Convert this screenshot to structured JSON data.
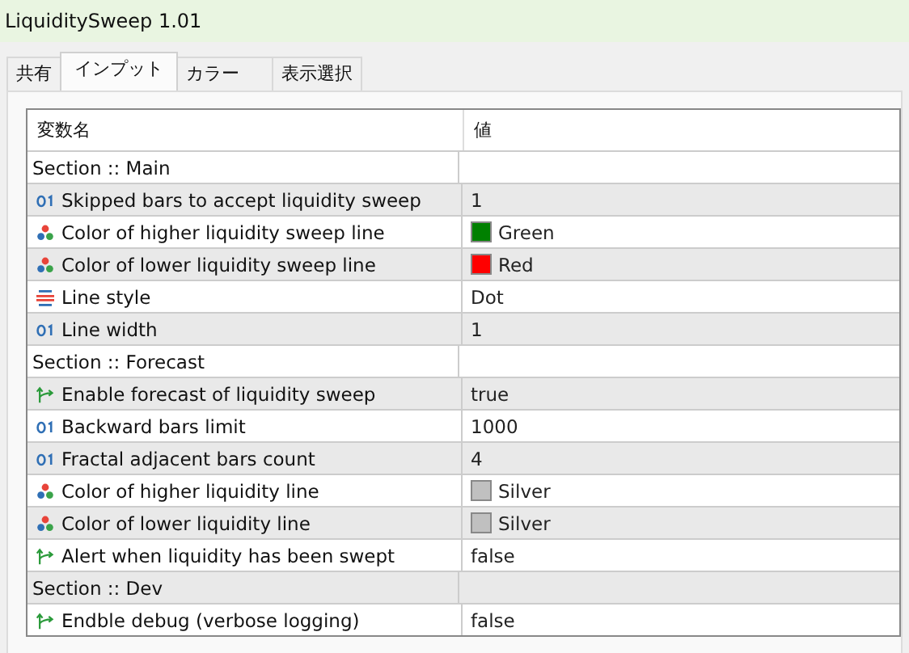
{
  "window": {
    "title": "LiquiditySweep 1.01"
  },
  "tabs": [
    {
      "label": "共有",
      "selected": false
    },
    {
      "label": "インプット",
      "selected": true
    },
    {
      "label": "カラー",
      "selected": false
    },
    {
      "label": "表示選択",
      "selected": false
    }
  ],
  "table": {
    "columns": [
      "変数名",
      "値"
    ],
    "rows": [
      {
        "kind": "section",
        "name": "Section :: Main"
      },
      {
        "kind": "int",
        "name": "Skipped bars to accept liquidity sweep",
        "value": "1"
      },
      {
        "kind": "color",
        "name": "Color of higher liquidity sweep line",
        "value": "Green",
        "color": "#008000"
      },
      {
        "kind": "color",
        "name": "Color of lower liquidity sweep line",
        "value": "Red",
        "color": "#ff0000"
      },
      {
        "kind": "enum",
        "name": "Line style",
        "value": "Dot"
      },
      {
        "kind": "int",
        "name": "Line width",
        "value": "1"
      },
      {
        "kind": "section",
        "name": "Section :: Forecast"
      },
      {
        "kind": "bool",
        "name": "Enable forecast of liquidity sweep",
        "value": "true"
      },
      {
        "kind": "int",
        "name": "Backward bars limit",
        "value": "1000"
      },
      {
        "kind": "int",
        "name": "Fractal adjacent bars count",
        "value": "4"
      },
      {
        "kind": "color",
        "name": "Color of higher liquidity line",
        "value": "Silver",
        "color": "#c0c0c0"
      },
      {
        "kind": "color",
        "name": "Color of lower liquidity line",
        "value": "Silver",
        "color": "#c0c0c0"
      },
      {
        "kind": "bool",
        "name": "Alert when liquidity has been swept",
        "value": "false"
      },
      {
        "kind": "section",
        "name": "Section :: Dev"
      },
      {
        "kind": "bool",
        "name": "Endble debug (verbose logging)",
        "value": "false"
      }
    ]
  }
}
